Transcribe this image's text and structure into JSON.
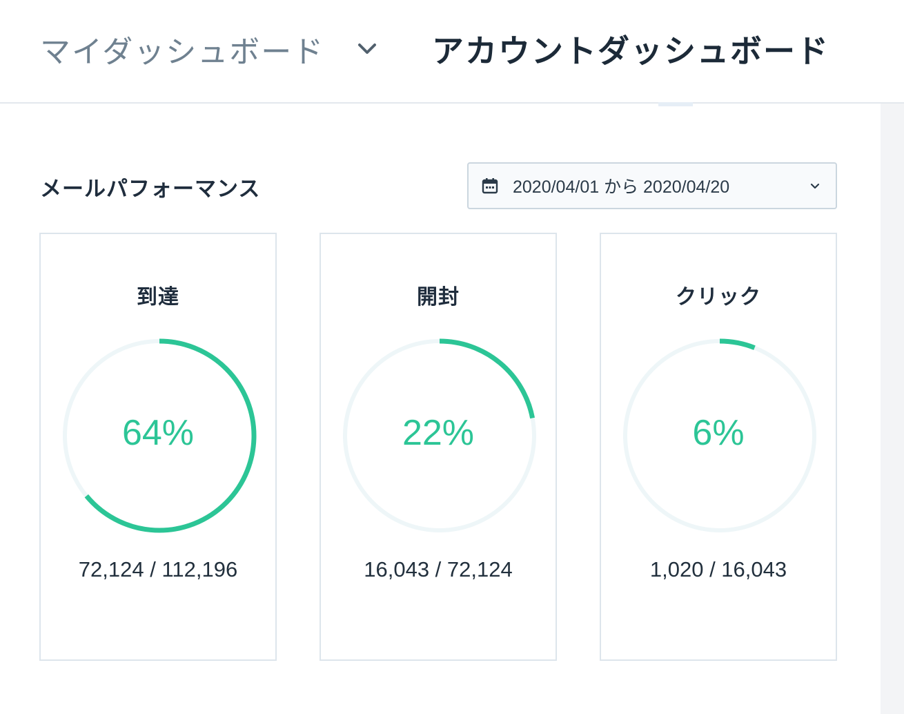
{
  "header": {
    "dashboard_select_label": "マイダッシュボード",
    "active_tab_label": "アカウントダッシュボード"
  },
  "section": {
    "title": "メールパフォーマンス",
    "date_range": {
      "label": "2020/04/01 から 2020/04/20"
    }
  },
  "cards": [
    {
      "title": "到達",
      "percent_label": "64%",
      "percent_value": 64,
      "ratio": "72,124 / 112,196"
    },
    {
      "title": "開封",
      "percent_label": "22%",
      "percent_value": 22,
      "ratio": "16,043 / 72,124"
    },
    {
      "title": "クリック",
      "percent_label": "6%",
      "percent_value": 6,
      "ratio": "1,020 / 16,043"
    }
  ],
  "icons": {
    "dashboard_select": "chevron-down-icon",
    "date_range": "calendar-icon",
    "date_range_dropdown": "chevron-down-icon"
  },
  "colors": {
    "accent": "#2cc596",
    "ring_track": "#eef6f8",
    "heading": "#1f2d3d",
    "muted": "#6f8190",
    "border": "#dde5ec"
  }
}
